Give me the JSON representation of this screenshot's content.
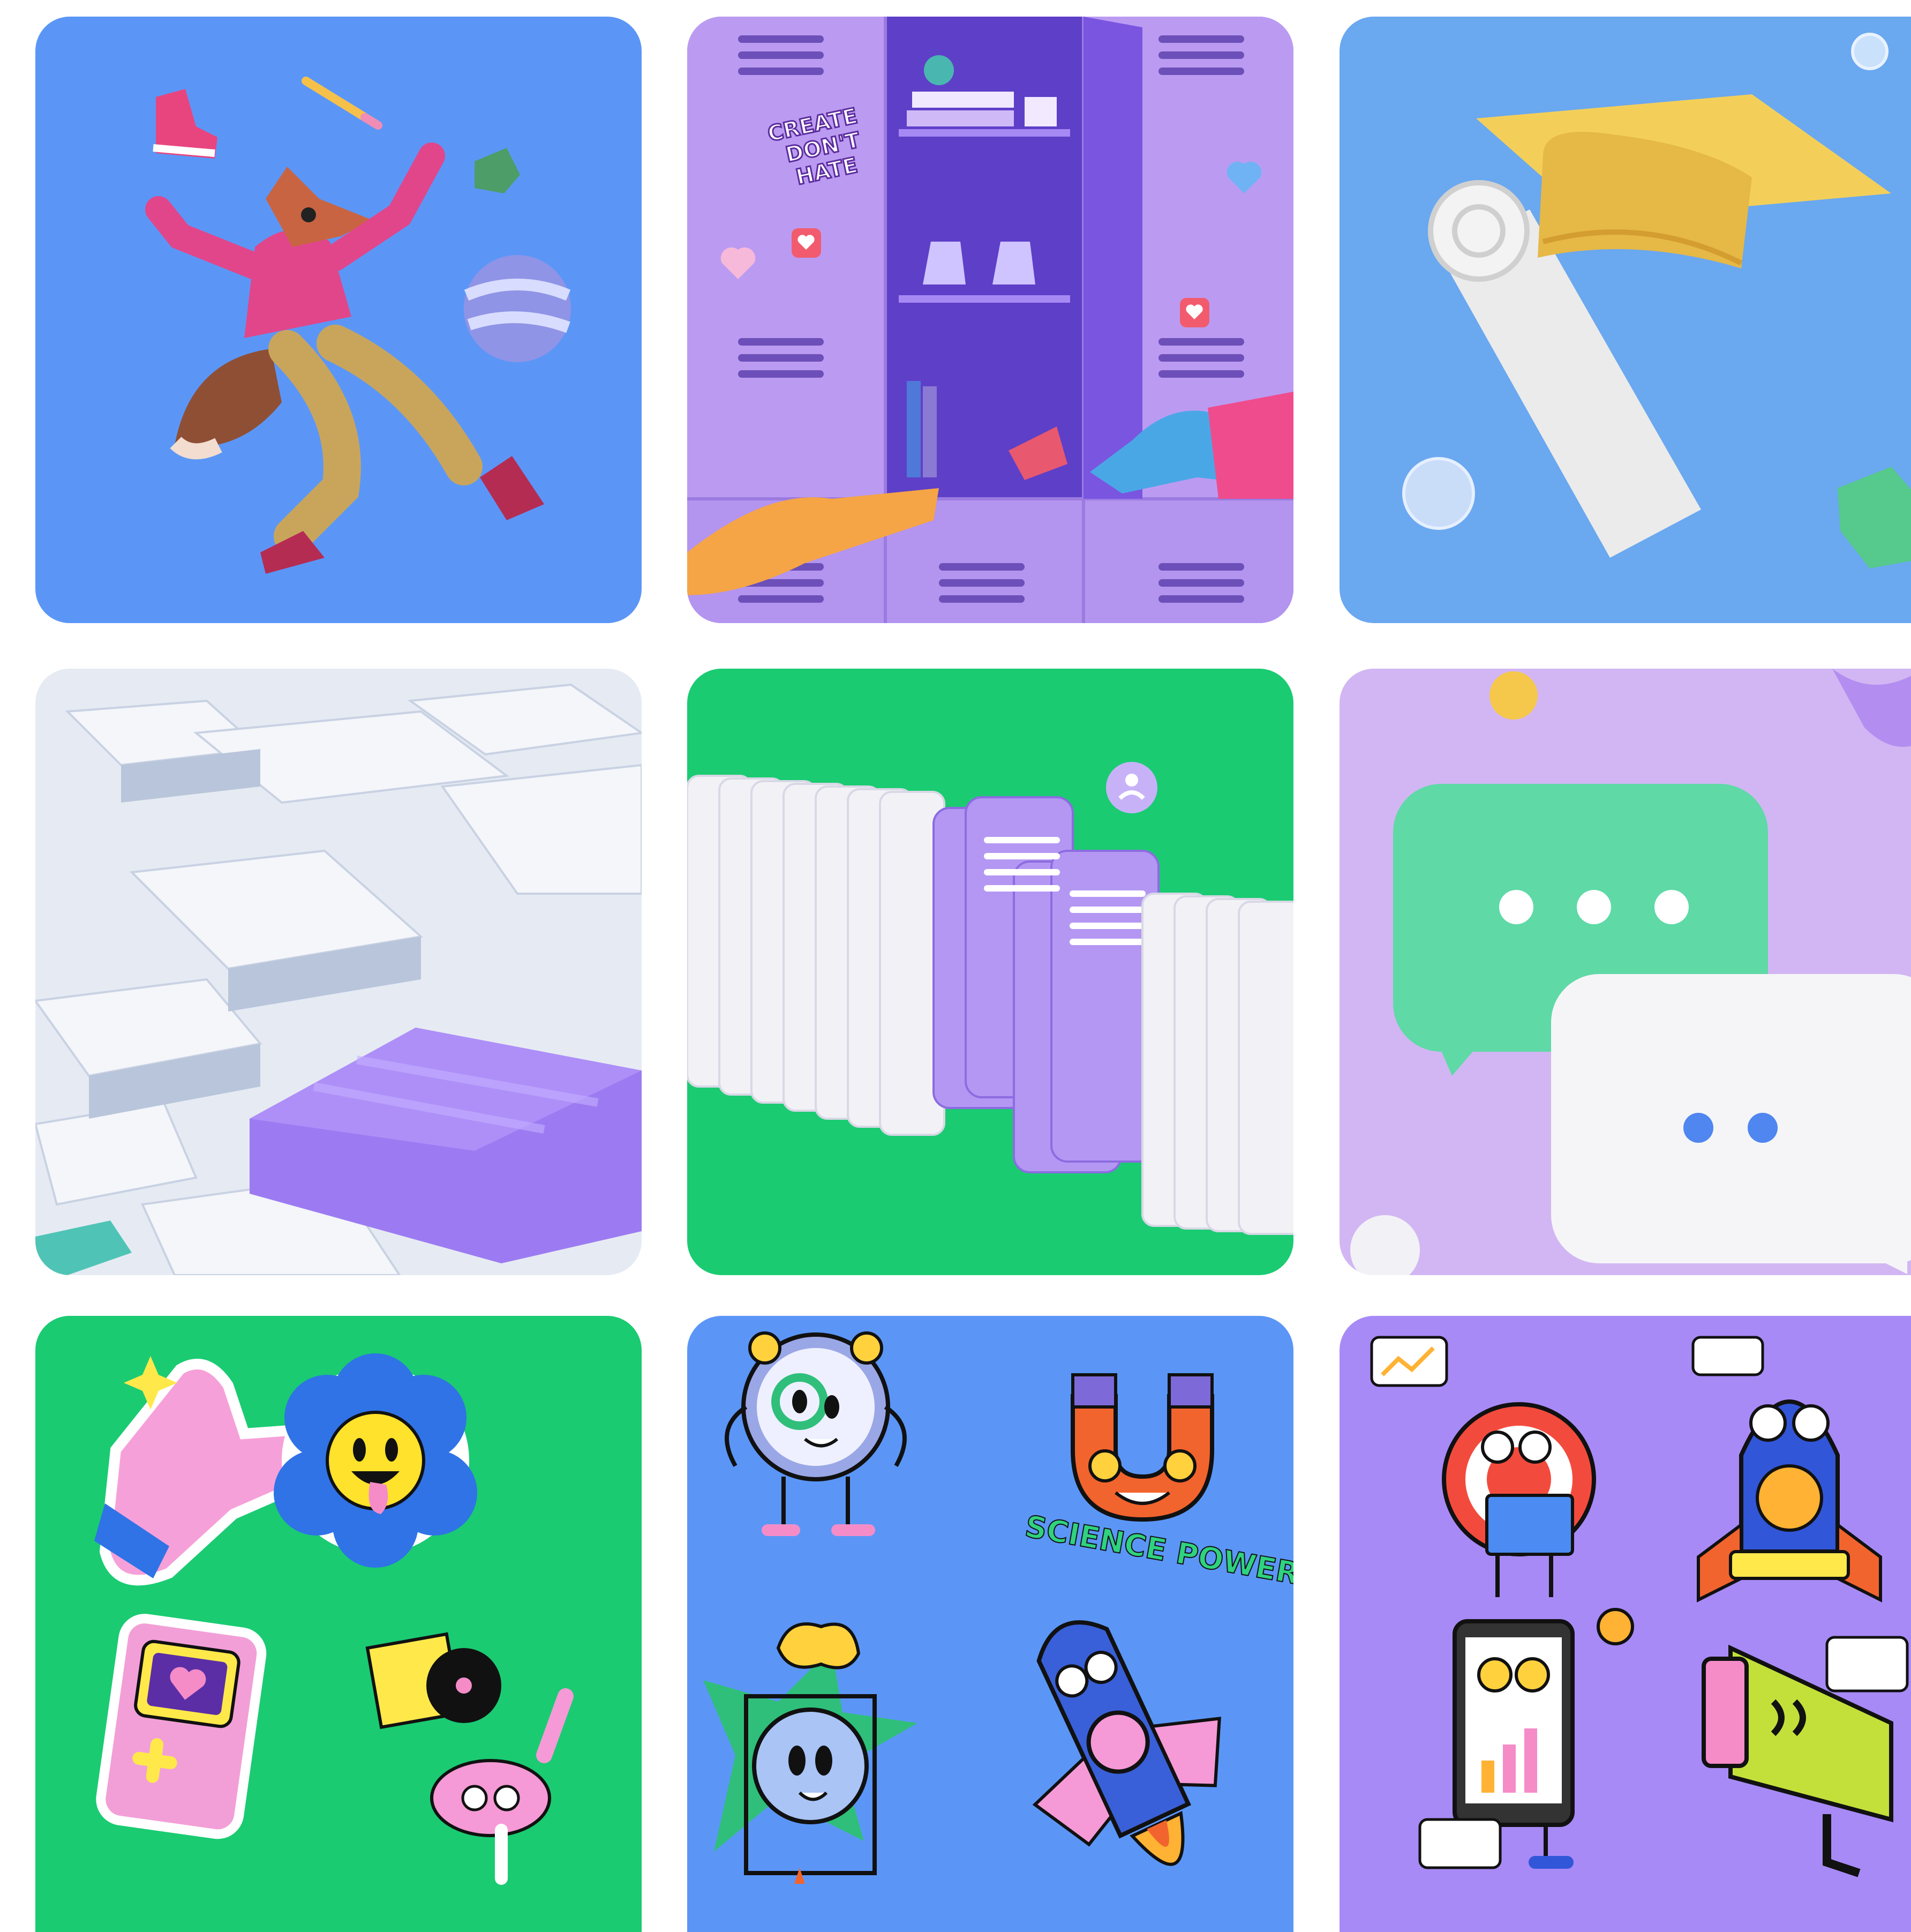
{
  "colors": {
    "page_bg": "#ffffff",
    "blue_tile": "#5b96f7",
    "purple_tile": "#b190ee",
    "sky_tile": "#6aa8f0",
    "grey_tile": "#e6ebf3",
    "green_tile": "#1acb72",
    "lilac_tile": "#d2b6f3",
    "violet_tile": "#a78af6"
  },
  "locker": {
    "sticker_line1": "CREATE",
    "sticker_line2": "DON'T",
    "sticker_line3": "HATE"
  },
  "science": {
    "caption": "SCIENCE POWER"
  },
  "tiles": [
    {
      "id": "fox-juggling",
      "icon": "fox-character-icon"
    },
    {
      "id": "lockers",
      "icon": "locker-icon"
    },
    {
      "id": "graduation",
      "icon": "graduation-cap-icon"
    },
    {
      "id": "blocks",
      "icon": "blocks-icon"
    },
    {
      "id": "cards",
      "icon": "cards-icon"
    },
    {
      "id": "chat-bubbles",
      "icon": "chat-bubble-icon"
    },
    {
      "id": "stickers-green",
      "icon": "sticker-icon"
    },
    {
      "id": "stickers-science",
      "icon": "science-icon"
    },
    {
      "id": "stickers-business",
      "icon": "business-icon"
    }
  ]
}
